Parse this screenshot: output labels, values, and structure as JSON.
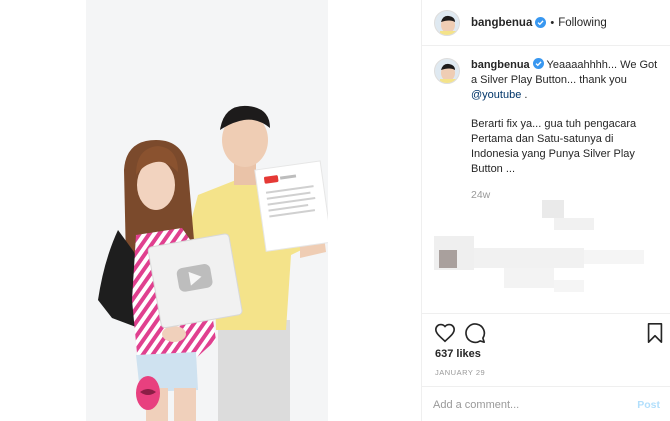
{
  "post": {
    "username": "bangbenua",
    "follow_status": "Following",
    "separator": "•"
  },
  "caption": {
    "username": "bangbenua",
    "text": "Yeaaaahhhh... We Got a Silver Play Button... thank you ",
    "mention": "@youtube",
    "mention_suffix": " .",
    "text2": "Berarti fix ya... gua tuh pengacara Pertama dan Satu-satunya di Indonesia yang Punya Silver Play Button ...",
    "time_ago": "24w"
  },
  "stats": {
    "likes": "637 likes",
    "date": "JANUARY 29"
  },
  "comment_box": {
    "placeholder": "Add a comment...",
    "post_label": "Post"
  },
  "icons": [
    "verified-badge-icon",
    "heart-icon",
    "comment-icon",
    "bookmark-icon",
    "play-button-plaque"
  ],
  "colors": {
    "verified_blue": "#3897f0",
    "text": "#262626",
    "muted": "#999999",
    "mention": "#003569",
    "post_disabled": "#b2dffc",
    "pink_top": "#e0408f",
    "yellow_shirt": "#f4e38a"
  }
}
